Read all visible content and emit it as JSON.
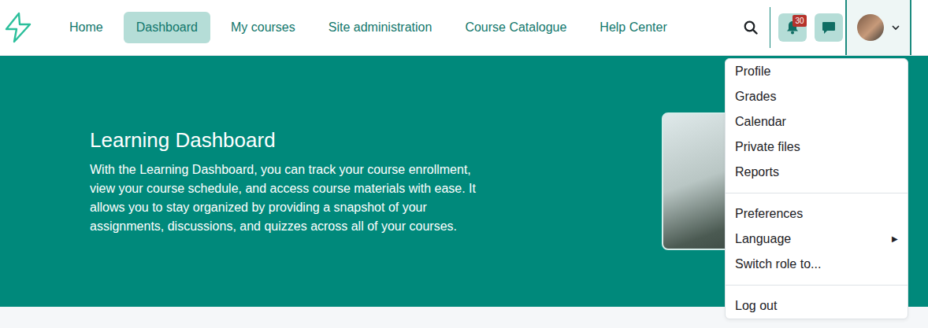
{
  "nav": {
    "items": [
      {
        "label": "Home",
        "selected": false
      },
      {
        "label": "Dashboard",
        "selected": true
      },
      {
        "label": "My courses",
        "selected": false
      },
      {
        "label": "Site administration",
        "selected": false
      },
      {
        "label": "Course Catalogue",
        "selected": false
      },
      {
        "label": "Help Center",
        "selected": false
      }
    ]
  },
  "notifications": {
    "count": "30"
  },
  "user_menu": {
    "expanded": true,
    "groups": [
      {
        "items": [
          {
            "label": "Profile"
          },
          {
            "label": "Grades"
          },
          {
            "label": "Calendar"
          },
          {
            "label": "Private files"
          },
          {
            "label": "Reports"
          }
        ]
      },
      {
        "items": [
          {
            "label": "Preferences"
          },
          {
            "label": "Language",
            "arrow": "▶"
          },
          {
            "label": "Switch role to..."
          }
        ]
      },
      {
        "items": [
          {
            "label": "Log out"
          }
        ]
      }
    ]
  },
  "hero": {
    "title": "Learning Dashboard",
    "text": "With the Learning Dashboard, you can track your course enrollment, view your course schedule, and access course materials with ease. It allows you to stay organized by providing a snapshot of your assignments, discussions, and quizzes across all of your courses."
  }
}
